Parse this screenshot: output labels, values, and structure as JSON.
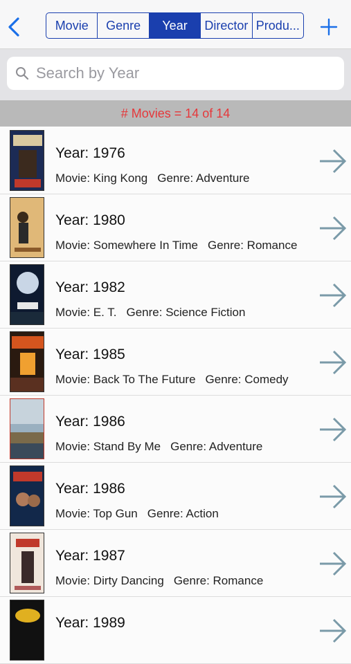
{
  "nav": {
    "segments": [
      "Movie",
      "Genre",
      "Year",
      "Director",
      "Produ..."
    ],
    "active_segment": "Year",
    "back_icon": "chevron-left-icon",
    "add_icon": "plus-icon",
    "accent_color": "#1a3fae"
  },
  "search": {
    "placeholder": "Search by Year",
    "value": ""
  },
  "count": {
    "text": "# Movies = 14 of 14",
    "color": "#e5383b"
  },
  "movies": [
    {
      "year_text": "Year: 1976",
      "movie_text": "Movie: King Kong",
      "genre_text": "Genre: Adventure"
    },
    {
      "year_text": "Year: 1980",
      "movie_text": "Movie: Somewhere In Time",
      "genre_text": "Genre: Romance"
    },
    {
      "year_text": "Year: 1982",
      "movie_text": "Movie: E. T.",
      "genre_text": "Genre: Science Fiction"
    },
    {
      "year_text": "Year: 1985",
      "movie_text": "Movie: Back To The Future",
      "genre_text": "Genre: Comedy"
    },
    {
      "year_text": "Year: 1986",
      "movie_text": "Movie: Stand By Me",
      "genre_text": "Genre: Adventure"
    },
    {
      "year_text": "Year: 1986",
      "movie_text": "Movie: Top Gun",
      "genre_text": "Genre: Action"
    },
    {
      "year_text": "Year: 1987",
      "movie_text": "Movie: Dirty Dancing",
      "genre_text": "Genre: Romance"
    },
    {
      "year_text": "Year: 1989",
      "movie_text": "",
      "genre_text": ""
    }
  ]
}
